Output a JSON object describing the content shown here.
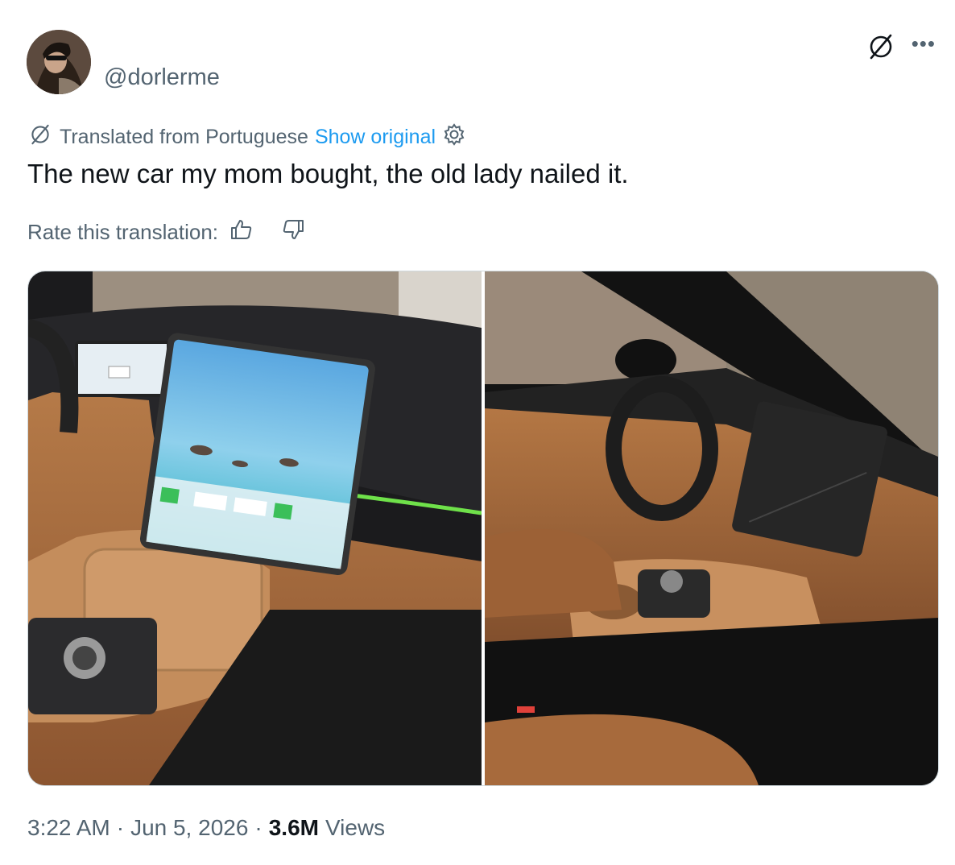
{
  "author": {
    "handle": "@dorlerme"
  },
  "translation": {
    "label": "Translated from Portuguese",
    "show_original": "Show original",
    "rate_label": "Rate this translation:"
  },
  "tweet": {
    "text": "The new car my mom bought, the old lady nailed it."
  },
  "meta": {
    "time": "3:22 AM",
    "sep1": "·",
    "date": "Jun 5, 2026",
    "sep2": "·",
    "views_count": "3.6M",
    "views_label": "Views"
  },
  "icons": {
    "translate": "translate-icon",
    "more": "more-icon",
    "settings": "gear-icon",
    "thumbs_up": "thumbs-up-icon",
    "thumbs_down": "thumbs-down-icon"
  },
  "colors": {
    "link": "#1d9bf0",
    "secondary_text": "#536471",
    "primary_text": "#0f1419",
    "border": "#cfd9de"
  }
}
